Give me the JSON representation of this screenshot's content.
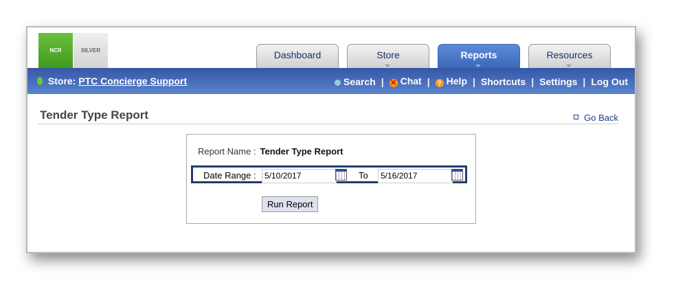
{
  "logos": {
    "ncr": "NCR",
    "silver": "SILVER"
  },
  "tabs": [
    {
      "label": "Dashboard"
    },
    {
      "label": "Store"
    },
    {
      "label": "Reports"
    },
    {
      "label": "Resources"
    }
  ],
  "store": {
    "label": "Store:",
    "name": "PTC Concierge Support"
  },
  "nav": {
    "search": "Search",
    "chat": "Chat",
    "help": "Help",
    "shortcuts": "Shortcuts",
    "settings": "Settings",
    "logout": "Log Out",
    "sep": "|"
  },
  "page": {
    "title": "Tender Type Report",
    "go_back": "Go Back"
  },
  "form": {
    "report_name_label": "Report Name :",
    "report_name": "Tender Type Report",
    "date_range_label": "Date Range :",
    "from": "5/10/2017",
    "to_label": "To",
    "to": "5/16/2017",
    "run": "Run Report"
  }
}
